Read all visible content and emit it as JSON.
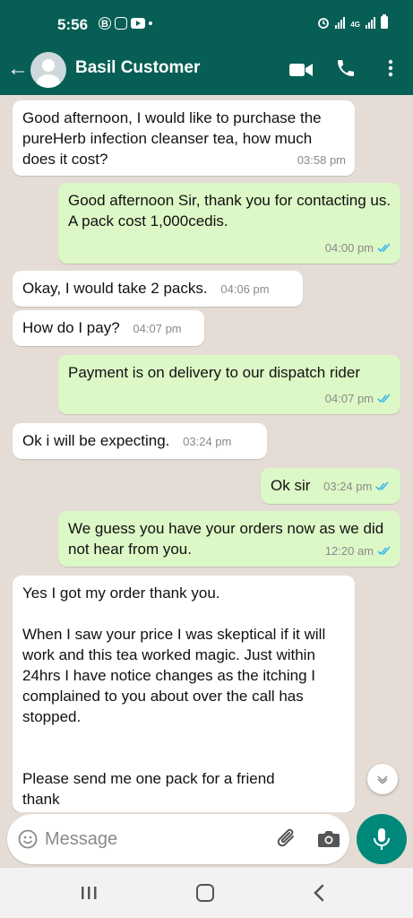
{
  "status_bar": {
    "time": "5:56",
    "network_label": "4G"
  },
  "header": {
    "contact_name": "Basil Customer"
  },
  "messages": [
    {
      "dir": "in",
      "text": "Good afternoon, I would like to purchase the pureHerb infection cleanser tea, how much does it cost?",
      "time": "03:58 pm"
    },
    {
      "dir": "out",
      "text": "Good afternoon Sir, thank you for contacting us.\nA pack cost 1,000cedis.",
      "time": "04:00 pm"
    },
    {
      "dir": "in",
      "text": "Okay, I would take 2 packs.",
      "time": "04:06 pm"
    },
    {
      "dir": "in",
      "text": "How do I pay?",
      "time": "04:07 pm"
    },
    {
      "dir": "out",
      "text": "Payment is on delivery to our dispatch rider",
      "time": "04:07 pm"
    },
    {
      "dir": "in",
      "text": "Ok i will be expecting.",
      "time": "03:24 pm"
    },
    {
      "dir": "out",
      "text": "Ok sir",
      "time": "03:24 pm"
    },
    {
      "dir": "out",
      "text": "We guess you have your orders now as we did not hear from you.",
      "time": "12:20 am"
    },
    {
      "dir": "in",
      "text": "Yes I got my order thank you.\n\nWhen I saw your price I was skeptical if it will work and this tea worked magic. Just within 24hrs I have notice changes as the itching I complained to you about over the call has stopped.\n\n\nPlease send me one pack for a friend\nthank"
    }
  ],
  "input": {
    "placeholder": "Message"
  },
  "colors": {
    "header": "#075e54",
    "outgoing_bubble": "#dcf8c6",
    "incoming_bubble": "#ffffff",
    "chat_bg": "#e5ddd5",
    "tick_read": "#34b7f1",
    "mic_button": "#00897b"
  },
  "icons": [
    "back-arrow-icon",
    "avatar-icon",
    "video-call-icon",
    "phone-icon",
    "more-options-icon",
    "read-ticks-icon",
    "chevron-down-icon",
    "emoji-icon",
    "attach-icon",
    "camera-icon",
    "mic-icon",
    "recent-apps-icon",
    "home-icon",
    "nav-back-icon"
  ]
}
